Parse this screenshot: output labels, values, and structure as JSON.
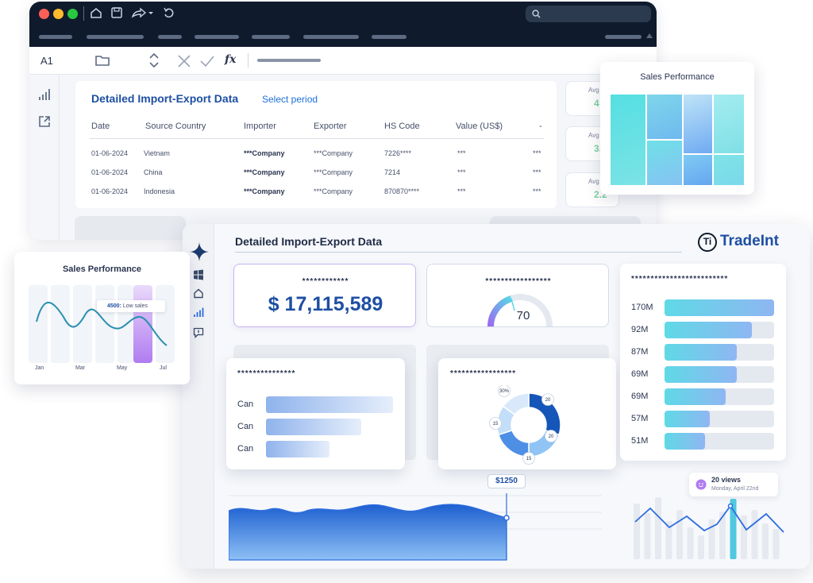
{
  "spreadsheet": {
    "cell_ref": "A1",
    "formula_label": "fx",
    "table_title": "Detailed Import-Export Data",
    "select_period": "Select period",
    "columns": [
      "Date",
      "Source Country",
      "Importer",
      "Exporter",
      "HS Code",
      "Value (US$)",
      "-"
    ],
    "rows": [
      [
        "01-06-2024",
        "Vietnam",
        "***Company",
        "***Company",
        "7226****",
        "***",
        "***"
      ],
      [
        "01-06-2024",
        "China",
        "***Company",
        "***Company",
        "7214",
        "***",
        "***"
      ],
      [
        "01-06-2024",
        "Indonesia",
        "***Company",
        "***Company",
        "870870****",
        "***",
        "***"
      ]
    ],
    "avg_cards": [
      {
        "label": "Avg",
        "value": "4"
      },
      {
        "label": "Avg",
        "value": "3."
      },
      {
        "label": "Avg",
        "value": "2.2"
      }
    ]
  },
  "treemap_card": {
    "title": "Sales Performance"
  },
  "left_card": {
    "title": "Sales Performance",
    "tooltip_value": "4500:",
    "tooltip_text": "Low sales",
    "months": [
      "Jan",
      "Mar",
      "May",
      "Jul"
    ]
  },
  "dashboard": {
    "title": "Detailed Import-Export Data",
    "brand": "TradeInt",
    "brand_mark": "Ti",
    "total_masked": "************",
    "total_value": "$ 17,115,589",
    "gauge_masked": "*****************",
    "gauge_value": "70",
    "bar_card_masked": "***************",
    "bar_labels": [
      "Can",
      "Can",
      "Can"
    ],
    "bar_fractions": [
      1.0,
      0.75,
      0.5
    ],
    "donut_masked": "*****************",
    "donut_labels": [
      "30%",
      "20",
      "20",
      "15",
      "15"
    ],
    "right_masked": "*************************",
    "right_labels": [
      "170M",
      "92M",
      "87M",
      "69M",
      "69M",
      "57M",
      "51M"
    ],
    "right_fractions": [
      1.0,
      0.8,
      0.66,
      0.66,
      0.56,
      0.41,
      0.37
    ],
    "area_tooltip": "$1250",
    "views_title": "20 views",
    "views_date": "Monday, April 22nd"
  },
  "colors": {
    "navy": "#0f1b2d",
    "brand_blue": "#1d4fa3",
    "teal": "#5fd9e6",
    "purple": "#b07cf0"
  }
}
